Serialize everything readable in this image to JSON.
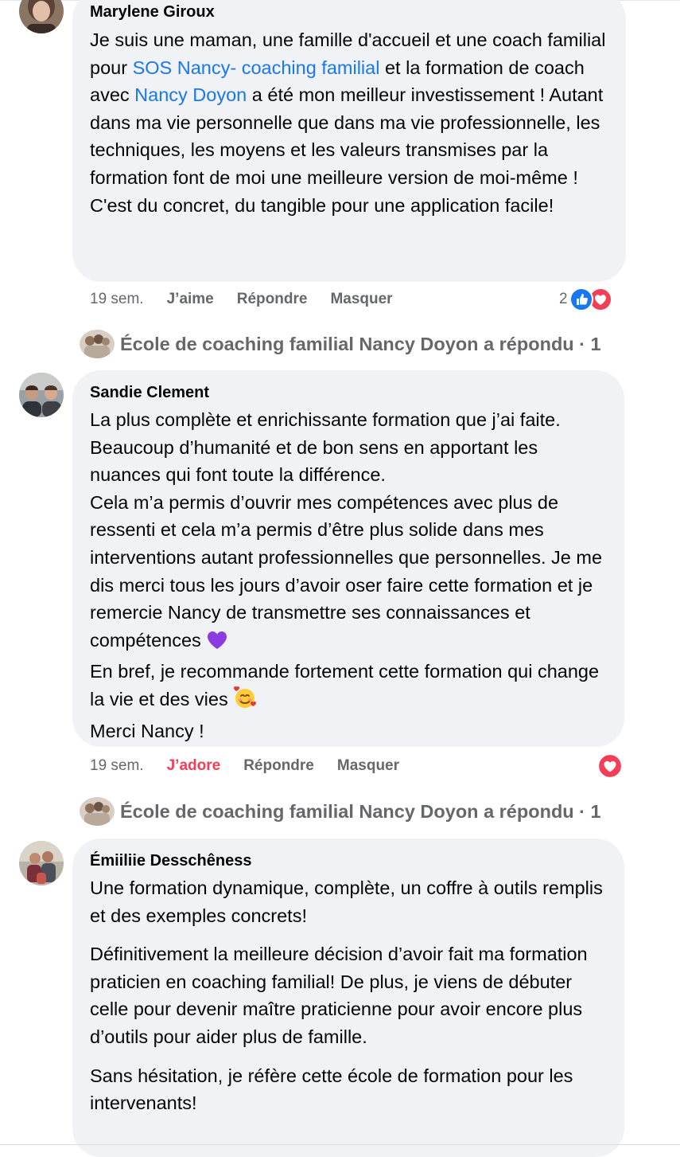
{
  "comments": [
    {
      "author": "Marylene Giroux",
      "text_1": "Je suis une maman, une famille d'accueil et une coach familial pour ",
      "link_1": "SOS Nancy- coaching familial",
      "text_2": " et la formation de coach avec ",
      "link_2": "Nancy Doyon",
      "text_3": " a été mon meilleur investissement ! Autant dans ma vie personnelle que dans ma vie professionnelle, les techniques, les moyens et les valeurs transmises par la formation font de moi une meilleure version de moi-même ! C'est du concret, du tangible pour une application facile!",
      "time": "19 sem.",
      "like_label": "J’aime",
      "reply_label": "Répondre",
      "hide_label": "Masquer",
      "reaction_count": "2",
      "reactions": [
        "like-icon",
        "love-icon"
      ],
      "reply_summary": "École de coaching familial Nancy Doyon a répondu · 1"
    },
    {
      "author": "Sandie Clement",
      "lines": [
        "La plus complète et enrichissante formation que j’ai faite. Beaucoup d’humanité et de bon sens en apportant les nuances qui font toute la différence.",
        "Cela m’a permis d’ouvrir mes compétences avec plus de ressenti et cela m’a permis d’être plus solide dans mes interventions autant professionnelles que personnelles. Je me dis merci tous les jours d’avoir oser faire cette formation et je remercie Nancy de transmettre ses connaissances et compétences",
        "En bref, je recommande fortement cette formation qui change la vie et des vies",
        "Merci Nancy !"
      ],
      "emoji_1": "purple-heart-icon",
      "emoji_2": "smiling-face-with-hearts-icon",
      "time": "19 sem.",
      "like_label": "J’adore",
      "reply_label": "Répondre",
      "hide_label": "Masquer",
      "reactions": [
        "love-icon"
      ],
      "reply_summary": "École de coaching familial Nancy Doyon a répondu · 1"
    },
    {
      "author": "Émiiliie Desschêness",
      "paragraphs": [
        "Une formation dynamique, complète, un coffre à outils remplis et des exemples concrets!",
        "Définitivement la meilleure décision d’avoir fait ma formation praticien en coaching familial! De plus, je viens de débuter celle pour devenir maître praticienne pour avoir encore plus d’outils pour aider plus de famille.",
        "Sans hésitation, je réfère cette école de formation pour les intervenants!"
      ]
    }
  ],
  "colors": {
    "bubble": "#f0f2f5",
    "link": "#1877f2",
    "meta": "#65676b",
    "love": "#f33e58",
    "like": "#1877f2"
  }
}
